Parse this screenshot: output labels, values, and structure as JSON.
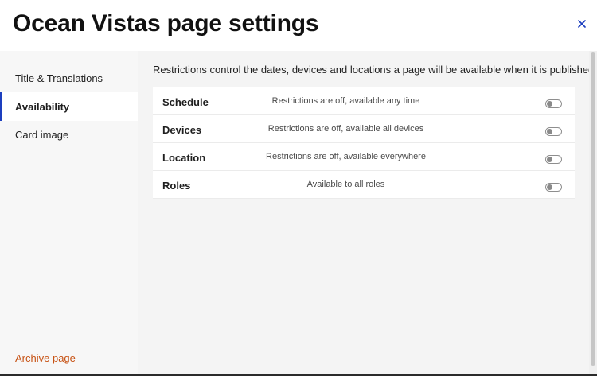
{
  "header": {
    "title": "Ocean Vistas page settings",
    "close_icon": "close-icon"
  },
  "sidebar": {
    "items": [
      {
        "label": "Title & Translations",
        "active": false
      },
      {
        "label": "Availability",
        "active": true
      },
      {
        "label": "Card image",
        "active": false
      }
    ],
    "archive_label": "Archive page"
  },
  "main": {
    "description": "Restrictions control the dates, devices and locations a page will be available when it is published",
    "restrictions": [
      {
        "label": "Schedule",
        "status": "Restrictions are off, available any time",
        "enabled": false
      },
      {
        "label": "Devices",
        "status": "Restrictions are off, available all devices",
        "enabled": false
      },
      {
        "label": "Location",
        "status": "Restrictions are off, available everywhere",
        "enabled": false
      },
      {
        "label": "Roles",
        "status": "Available to all roles",
        "enabled": false
      }
    ]
  },
  "colors": {
    "accent": "#1d3fbf",
    "danger": "#c75214",
    "sidebar_bg": "#f7f7f7",
    "content_bg": "#f4f4f4"
  }
}
